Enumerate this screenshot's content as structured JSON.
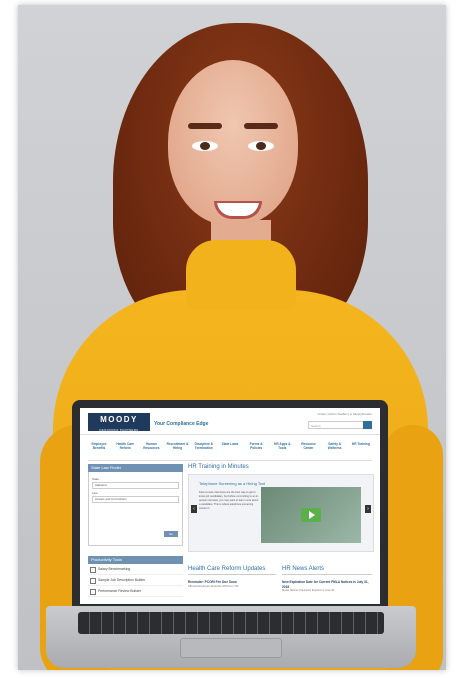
{
  "screen": {
    "brand": "MOODY",
    "brand_sub": "RESOURCE PARTNERS",
    "tagline": "Your Compliance Edge",
    "toplinks": "Group | Admin Toolbox | ● Simplyfounder",
    "search_placeholder": "Search",
    "nav": [
      {
        "label": "Employee Benefits"
      },
      {
        "label": "Health Care Reform"
      },
      {
        "label": "Human Resources"
      },
      {
        "label": "Recruitment & Hiring"
      },
      {
        "label": "Discipline & Termination"
      },
      {
        "label": "State Laws"
      },
      {
        "label": "Forms & Policies"
      },
      {
        "label": "HR Apps & Tools"
      },
      {
        "label": "Resource Center"
      },
      {
        "label": "Safety & Wellness"
      },
      {
        "label": "HR Training"
      }
    ],
    "state_law_finder": {
      "title": "State Law Finder",
      "state_label": "State",
      "state_value": "Alabama",
      "law_label": "Law",
      "law_value": "Arrests and Convictions",
      "go": "Go"
    },
    "productivity_tools": {
      "title": "Productivity Tools",
      "items": [
        {
          "label": "Salary Benchmarking"
        },
        {
          "label": "Sample Job Description Builder"
        },
        {
          "label": "Performance Review Builder"
        }
      ]
    },
    "hr_training": {
      "title": "HR Training in Minutes",
      "video_title": "Telephone Screening as a Hiring Tool",
      "video_text": "Face-to-face interviews are the best way to get to know job candidates, but before committing to an in-person interview, you may want to learn more about a candidate. This is where telephone screening comes in."
    },
    "hcr_updates": {
      "title": "Health Care Reform Updates",
      "headline": "Reminder: PCORI Fee Due Soon",
      "text": "Affected Employers Must File IRS Form 720"
    },
    "hr_news": {
      "title": "HR News Alerts",
      "headline": "New Expiration Date for Current FMLA Notices Is July 31, 2018",
      "text": "Model Notices Previously Expired on June 30"
    }
  }
}
